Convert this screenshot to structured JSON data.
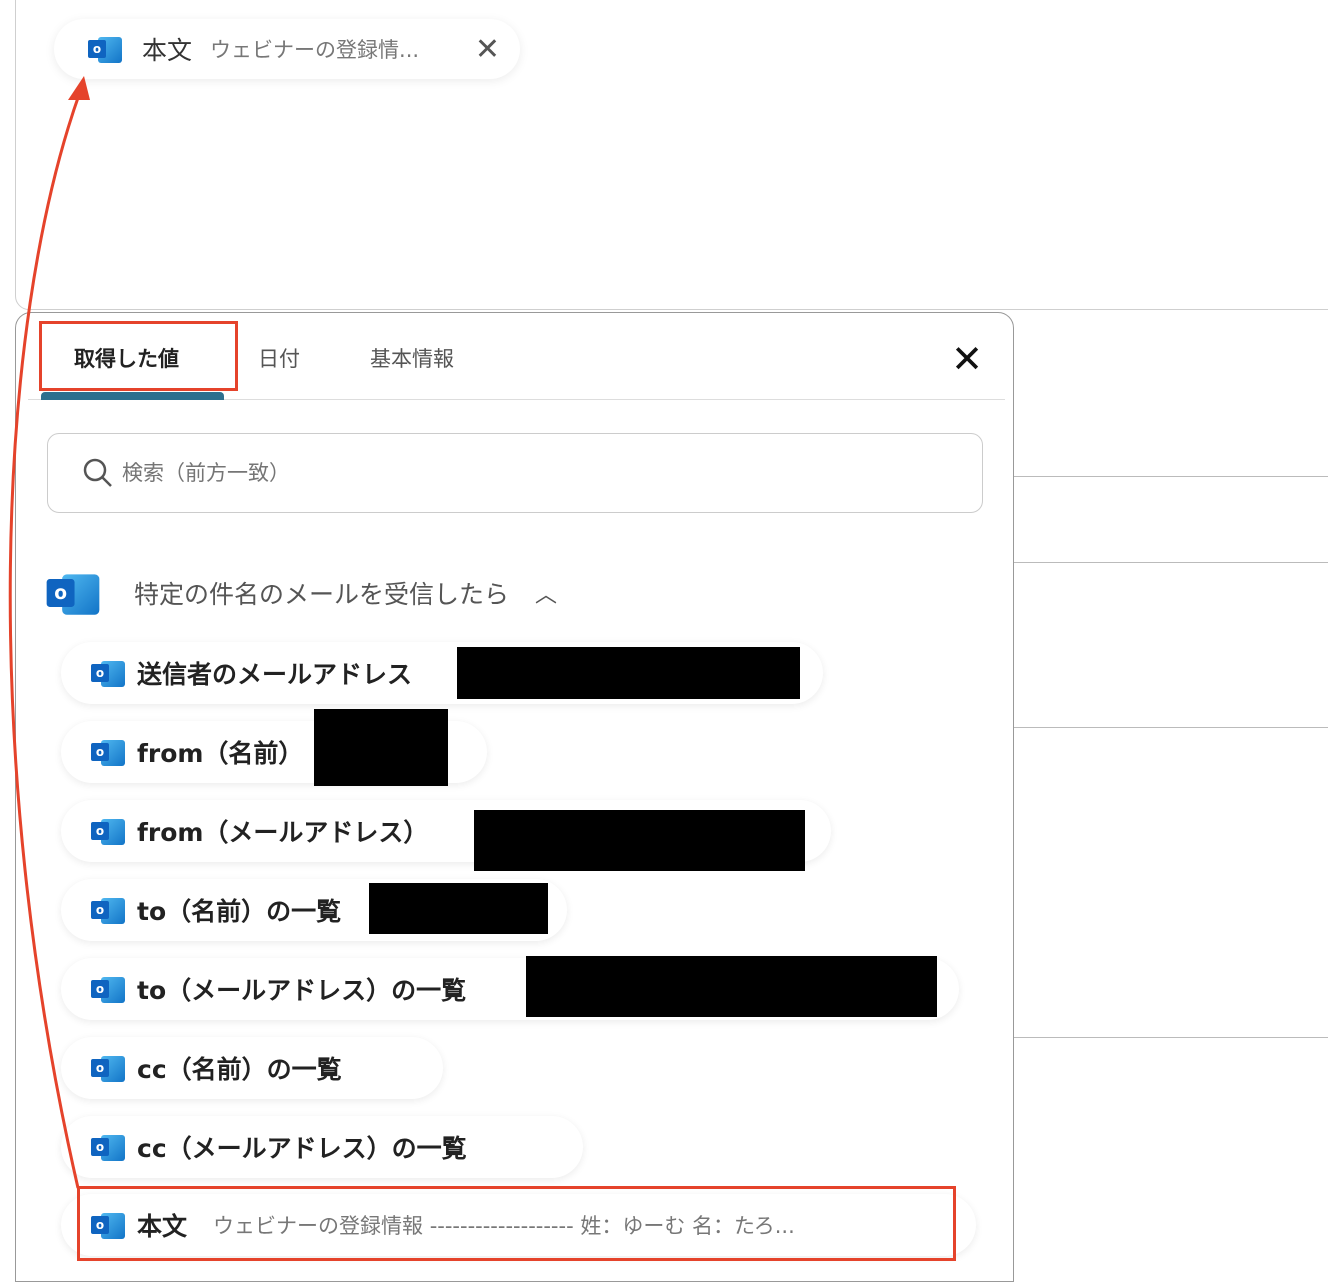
{
  "selected_chip": {
    "key": "本文",
    "value": "ウェビナーの登録情...",
    "icon": "outlook-icon"
  },
  "tabs": [
    {
      "label": "取得した値"
    },
    {
      "label": "日付"
    },
    {
      "label": "基本情報"
    }
  ],
  "search": {
    "placeholder": "検索（前方一致）"
  },
  "group": {
    "title": "特定の件名のメールを受信したら",
    "icon": "outlook-icon"
  },
  "items": [
    {
      "label": "送信者のメールアドレス"
    },
    {
      "label": "from（名前）"
    },
    {
      "label": "from（メールアドレス）"
    },
    {
      "label": "to（名前）の一覧"
    },
    {
      "label": "to（メールアドレス）の一覧"
    },
    {
      "label": "cc（名前）の一覧"
    },
    {
      "label": "cc（メールアドレス）の一覧"
    },
    {
      "label": "本文",
      "value": "ウェビナーの登録情報 ------------------- 姓：ゆーむ 名：たろ..."
    }
  ],
  "colors": {
    "highlight": "#e5432b",
    "tab_indicator": "#2e6f8e"
  }
}
